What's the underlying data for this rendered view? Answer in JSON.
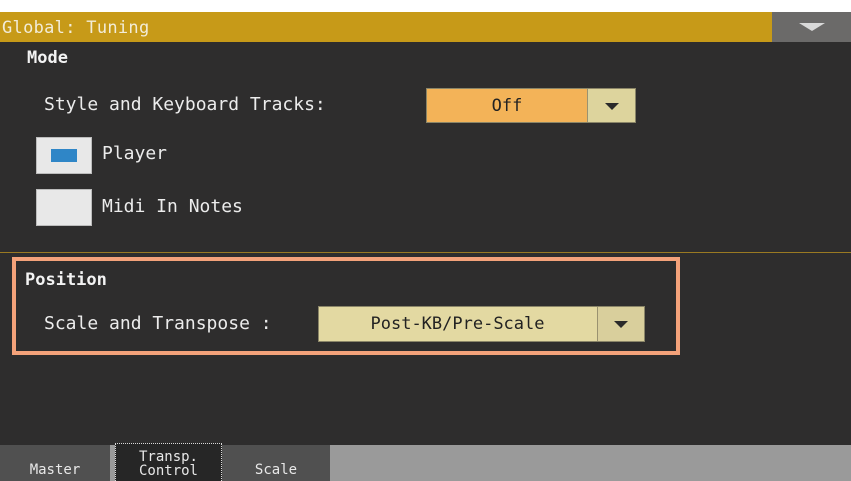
{
  "header": {
    "title": "Global: Tuning"
  },
  "mode": {
    "label": "Mode",
    "style_kb_label": "Style and Keyboard Tracks:",
    "style_kb_value": "Off",
    "player_label": "Player",
    "player_checked": true,
    "midi_in_label": "Midi In Notes",
    "midi_in_checked": false
  },
  "position": {
    "label": "Position",
    "scale_transpose_label": "Scale and Transpose :",
    "scale_transpose_value": "Post-KB/Pre-Scale"
  },
  "tabs": [
    {
      "label": "Master"
    },
    {
      "label": "Transp.\nControl",
      "active": true
    },
    {
      "label": "Scale"
    }
  ],
  "colors": {
    "title_bar": "#c79a18",
    "screen_bg": "#2e2d2d",
    "highlight_frame": "#f4a27a",
    "checkbox_mark": "#2f86c7"
  },
  "icons": {
    "menu": "dropdown-menu-icon",
    "combo_arrow": "chevron-down-icon"
  }
}
